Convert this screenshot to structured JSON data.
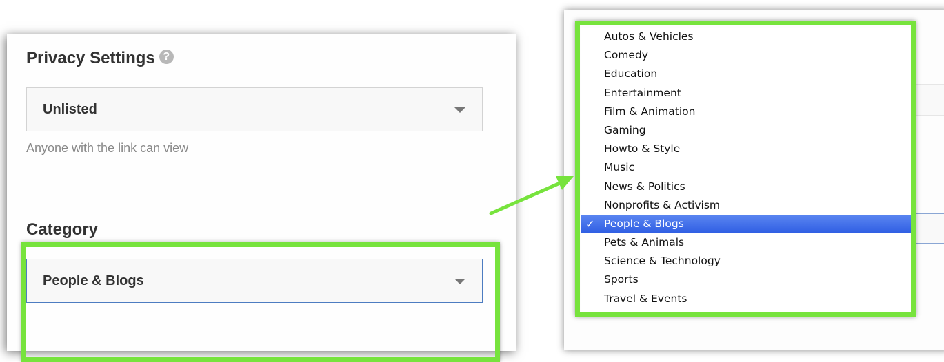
{
  "privacy": {
    "title": "Privacy Settings",
    "selected": "Unlisted",
    "helper": "Anyone with the link can view"
  },
  "category": {
    "title": "Category",
    "selected": "People & Blogs"
  },
  "dropdown": {
    "items": [
      {
        "label": "Autos & Vehicles"
      },
      {
        "label": "Comedy"
      },
      {
        "label": "Education"
      },
      {
        "label": "Entertainment"
      },
      {
        "label": "Film & Animation"
      },
      {
        "label": "Gaming"
      },
      {
        "label": "Howto & Style"
      },
      {
        "label": "Music"
      },
      {
        "label": "News & Politics"
      },
      {
        "label": "Nonprofits & Activism"
      },
      {
        "label": "People & Blogs",
        "selected": true
      },
      {
        "label": "Pets & Animals"
      },
      {
        "label": "Science & Technology"
      },
      {
        "label": "Sports"
      },
      {
        "label": "Travel & Events"
      }
    ],
    "check_glyph": "✓"
  },
  "colors": {
    "highlight": "#77e33d",
    "selected_bg": "#3b6ae8",
    "focus_border": "#4d7cc1"
  },
  "icons": {
    "help": "help-icon",
    "caret": "chevron-down-icon",
    "check": "check-icon",
    "arrow": "arrow-icon"
  }
}
